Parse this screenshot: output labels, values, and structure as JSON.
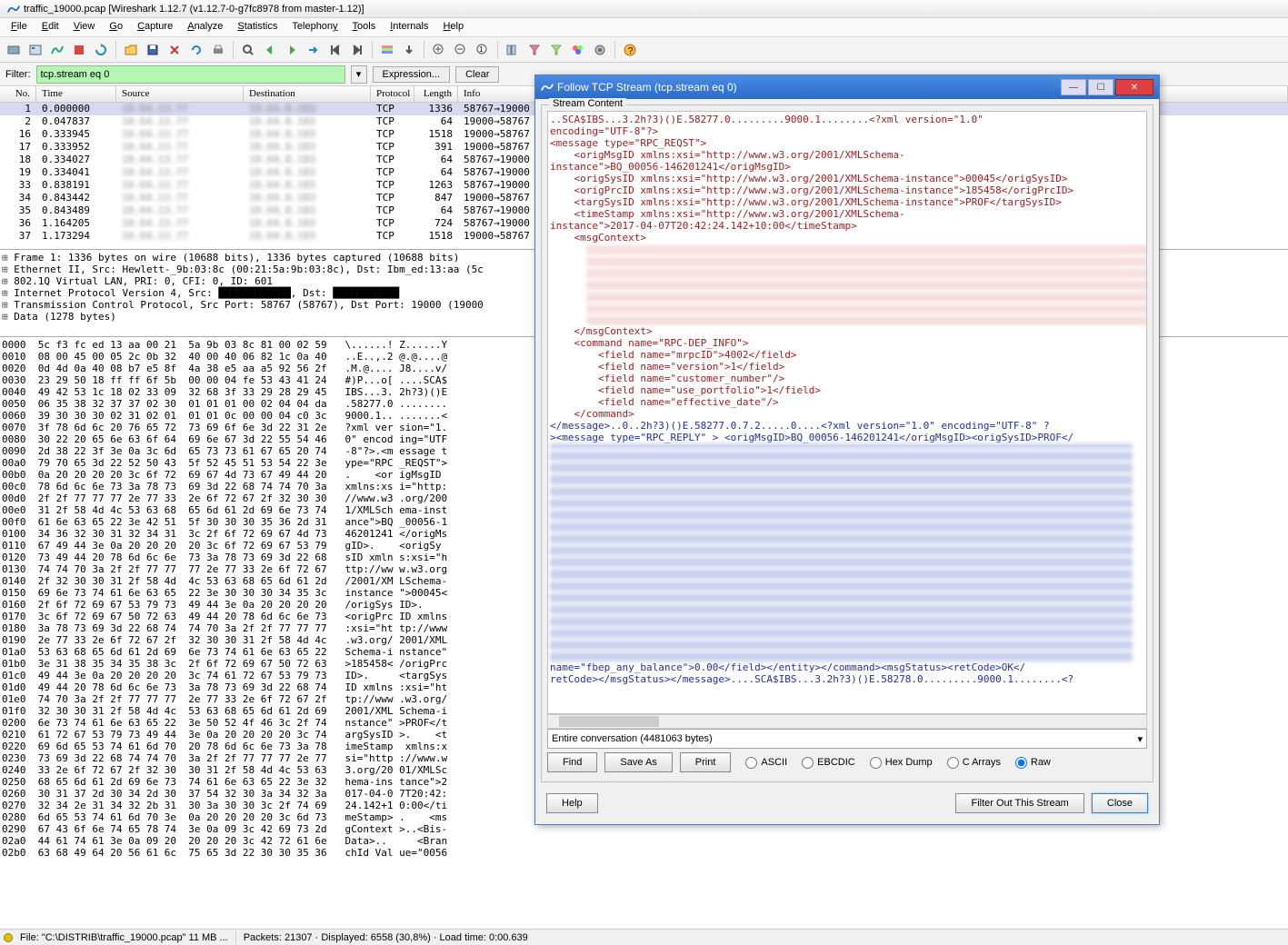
{
  "window": {
    "title": "traffic_19000.pcap   [Wireshark 1.12.7  (v1.12.7-0-g7fc8978 from master-1.12)]"
  },
  "menu": [
    "File",
    "Edit",
    "View",
    "Go",
    "Capture",
    "Analyze",
    "Statistics",
    "Telephony",
    "Tools",
    "Internals",
    "Help"
  ],
  "filter": {
    "label": "Filter:",
    "value": "tcp.stream eq 0",
    "expression": "Expression...",
    "clear": "Clear"
  },
  "columns": [
    "No.",
    "Time",
    "Source",
    "Destination",
    "Protocol",
    "Length",
    "Info"
  ],
  "packets": [
    {
      "no": "1",
      "time": "0.000000",
      "proto": "TCP",
      "len": "1336",
      "info": "58767→19000"
    },
    {
      "no": "2",
      "time": "0.047837",
      "proto": "TCP",
      "len": "64",
      "info": "19000→58767"
    },
    {
      "no": "16",
      "time": "0.333945",
      "proto": "TCP",
      "len": "1518",
      "info": "19000→58767"
    },
    {
      "no": "17",
      "time": "0.333952",
      "proto": "TCP",
      "len": "391",
      "info": "19000→58767"
    },
    {
      "no": "18",
      "time": "0.334027",
      "proto": "TCP",
      "len": "64",
      "info": "58767→19000"
    },
    {
      "no": "19",
      "time": "0.334041",
      "proto": "TCP",
      "len": "64",
      "info": "58767→19000"
    },
    {
      "no": "33",
      "time": "0.838191",
      "proto": "TCP",
      "len": "1263",
      "info": "58767→19000"
    },
    {
      "no": "34",
      "time": "0.843442",
      "proto": "TCP",
      "len": "847",
      "info": "19000→58767"
    },
    {
      "no": "35",
      "time": "0.843489",
      "proto": "TCP",
      "len": "64",
      "info": "58767→19000"
    },
    {
      "no": "36",
      "time": "1.164205",
      "proto": "TCP",
      "len": "724",
      "info": "58767→19000"
    },
    {
      "no": "37",
      "time": "1.173294",
      "proto": "TCP",
      "len": "1518",
      "info": "19000→58767"
    }
  ],
  "details": [
    "Frame 1: 1336 bytes on wire (10688 bits), 1336 bytes captured (10688 bits)",
    "Ethernet II, Src: Hewlett-_9b:03:8c (00:21:5a:9b:03:8c), Dst: Ibm_ed:13:aa (5c",
    "802.1Q Virtual LAN, PRI: 0, CFI: 0, ID: 601",
    "Internet Protocol Version 4, Src: ████████████, Dst: ███████████",
    "Transmission Control Protocol, Src Port: 58767 (58767), Dst Port: 19000 (19000",
    "Data (1278 bytes)"
  ],
  "hex": "0000  5c f3 fc ed 13 aa 00 21  5a 9b 03 8c 81 00 02 59   \\......! Z......Y\n0010  08 00 45 00 05 2c 0b 32  40 00 40 06 82 1c 0a 40   ..E..,.2 @.@....@\n0020  0d 4d 0a 40 08 b7 e5 8f  4a 38 e5 aa a5 92 56 2f   .M.@.... J8....v/\n0030  23 29 50 18 ff ff 6f 5b  00 00 04 fe 53 43 41 24   #)P...o[ ....SCA$\n0040  49 42 53 1c 18 02 33 09  32 68 3f 33 29 28 29 45   IBS...3. 2h?3)()E\n0050  06 35 38 32 37 37 02 30  01 01 01 00 02 04 04 da   .58277.0 ........\n0060  39 30 30 30 02 31 02 01  01 01 0c 00 00 04 c0 3c   9000.1.. .......<\n0070  3f 78 6d 6c 20 76 65 72  73 69 6f 6e 3d 22 31 2e   ?xml ver sion=\"1.\n0080  30 22 20 65 6e 63 6f 64  69 6e 67 3d 22 55 54 46   0\" encod ing=\"UTF\n0090  2d 38 22 3f 3e 0a 3c 6d  65 73 73 61 67 65 20 74   -8\"?>.<m essage t\n00a0  79 70 65 3d 22 52 50 43  5f 52 45 51 53 54 22 3e   ype=\"RPC _REQST\">\n00b0  0a 20 20 20 20 3c 6f 72  69 67 4d 73 67 49 44 20   .    <or igMsgID \n00c0  78 6d 6c 6e 73 3a 78 73  69 3d 22 68 74 74 70 3a   xmlns:xs i=\"http:\n00d0  2f 2f 77 77 77 2e 77 33  2e 6f 72 67 2f 32 30 30   //www.w3 .org/200\n00e0  31 2f 58 4d 4c 53 63 68  65 6d 61 2d 69 6e 73 74   1/XMLSch ema-inst\n00f0  61 6e 63 65 22 3e 42 51  5f 30 30 30 35 36 2d 31   ance\">BQ _00056-1\n0100  34 36 32 30 31 32 34 31  3c 2f 6f 72 69 67 4d 73   46201241 </origMs\n0110  67 49 44 3e 0a 20 20 20  20 3c 6f 72 69 67 53 79   gID>.    <origSy\n0120  73 49 44 20 78 6d 6c 6e  73 3a 78 73 69 3d 22 68   sID xmln s:xsi=\"h\n0130  74 74 70 3a 2f 2f 77 77  77 2e 77 33 2e 6f 72 67   ttp://ww w.w3.org\n0140  2f 32 30 30 31 2f 58 4d  4c 53 63 68 65 6d 61 2d   /2001/XM LSchema-\n0150  69 6e 73 74 61 6e 63 65  22 3e 30 30 30 34 35 3c   instance \">00045<\n0160  2f 6f 72 69 67 53 79 73  49 44 3e 0a 20 20 20 20   /origSys ID>.    \n0170  3c 6f 72 69 67 50 72 63  49 44 20 78 6d 6c 6e 73   <origPrc ID xmlns\n0180  3a 78 73 69 3d 22 68 74  74 70 3a 2f 2f 77 77 77   :xsi=\"ht tp://www\n0190  2e 77 33 2e 6f 72 67 2f  32 30 30 31 2f 58 4d 4c   .w3.org/ 2001/XML\n01a0  53 63 68 65 6d 61 2d 69  6e 73 74 61 6e 63 65 22   Schema-i nstance\"\n01b0  3e 31 38 35 34 35 38 3c  2f 6f 72 69 67 50 72 63   >185458< /origPrc\n01c0  49 44 3e 0a 20 20 20 20  3c 74 61 72 67 53 79 73   ID>.     <targSys\n01d0  49 44 20 78 6d 6c 6e 73  3a 78 73 69 3d 22 68 74   ID xmlns :xsi=\"ht\n01e0  74 70 3a 2f 2f 77 77 77  2e 77 33 2e 6f 72 67 2f   tp://www .w3.org/\n01f0  32 30 30 31 2f 58 4d 4c  53 63 68 65 6d 61 2d 69   2001/XML Schema-i\n0200  6e 73 74 61 6e 63 65 22  3e 50 52 4f 46 3c 2f 74   nstance\" >PROF</t\n0210  61 72 67 53 79 73 49 44  3e 0a 20 20 20 20 3c 74   argSysID >.    <t\n0220  69 6d 65 53 74 61 6d 70  20 78 6d 6c 6e 73 3a 78   imeStamp  xmlns:x\n0230  73 69 3d 22 68 74 74 70  3a 2f 2f 77 77 77 2e 77   si=\"http ://www.w\n0240  33 2e 6f 72 67 2f 32 30  30 31 2f 58 4d 4c 53 63   3.org/20 01/XMLSc\n0250  68 65 6d 61 2d 69 6e 73  74 61 6e 63 65 22 3e 32   hema-ins tance\">2\n0260  30 31 37 2d 30 34 2d 30  37 54 32 30 3a 34 32 3a   017-04-0 7T20:42:\n0270  32 34 2e 31 34 32 2b 31  30 3a 30 30 3c 2f 74 69   24.142+1 0:00</ti\n0280  6d 65 53 74 61 6d 70 3e  0a 20 20 20 20 3c 6d 73   meStamp> .    <ms\n0290  67 43 6f 6e 74 65 78 74  3e 0a 09 3c 42 69 73 2d   gContext >..<Bis-\n02a0  44 61 74 61 3e 0a 09 20  20 20 20 3c 42 72 61 6e   Data>..     <Bran\n02b0  63 68 49 64 20 56 61 6c  75 65 3d 22 30 30 35 36   chId Val ue=\"0056",
  "status": {
    "file": "File: \"C:\\DISTRIB\\traffic_19000.pcap\" 11 MB ...",
    "packets": "Packets: 21307 · Displayed: 6558 (30,8%) · Load time: 0:00.639"
  },
  "dialog": {
    "title": "Follow TCP Stream (tcp.stream eq 0)",
    "group": "Stream Content",
    "req": "..SCA$IBS...3.2h?3)()E.58277.0.........9000.1........<?xml version=\"1.0\"\nencoding=\"UTF-8\"?>\n<message type=\"RPC_REQST\">\n    <origMsgID xmlns:xsi=\"http://www.w3.org/2001/XMLSchema-\ninstance\">BQ_00056-146201241</origMsgID>\n    <origSysID xmlns:xsi=\"http://www.w3.org/2001/XMLSchema-instance\">00045</origSysID>\n    <origPrcID xmlns:xsi=\"http://www.w3.org/2001/XMLSchema-instance\">185458</origPrcID>\n    <targSysID xmlns:xsi=\"http://www.w3.org/2001/XMLSchema-instance\">PROF</targSysID>\n    <timeStamp xmlns:xsi=\"http://www.w3.org/2001/XMLSchema-\ninstance\">2017-04-07T20:42:24.142+10:00</timeStamp>\n    <msgContext>",
    "req2": "    </msgContext>\n    <command name=\"RPC-DEP_INFO\">\n        <field name=\"mrpcID\">4002</field>\n        <field name=\"version\">1</field>\n        <field name=\"customer_number\"/>\n        <field name=\"use_portfolio\">1</field>\n        <field name=\"effective_date\"/>\n    </command>",
    "rep": "</message>..0..2h?3)()E.58277.0.7.2.....0....<?xml version=\"1.0\" encoding=\"UTF-8\" ?\n><message type=\"RPC_REPLY\" > <origMsgID>BQ_00056-146201241</origMsgID><origSysID>PROF</",
    "rep2": "name=\"fbep_any_balance\">0.00</field></entity></command><msgStatus><retCode>OK</\nretCode></msgStatus></message>....SCA$IBS...3.2h?3)()E.58278.0.........9000.1........<?",
    "conversation": "Entire conversation (4481063 bytes)",
    "find": "Find",
    "saveas": "Save As",
    "print": "Print",
    "ascii": "ASCII",
    "ebcdic": "EBCDIC",
    "hexdump": "Hex Dump",
    "carrays": "C Arrays",
    "raw": "Raw",
    "help": "Help",
    "filterout": "Filter Out This Stream",
    "close": "Close"
  }
}
